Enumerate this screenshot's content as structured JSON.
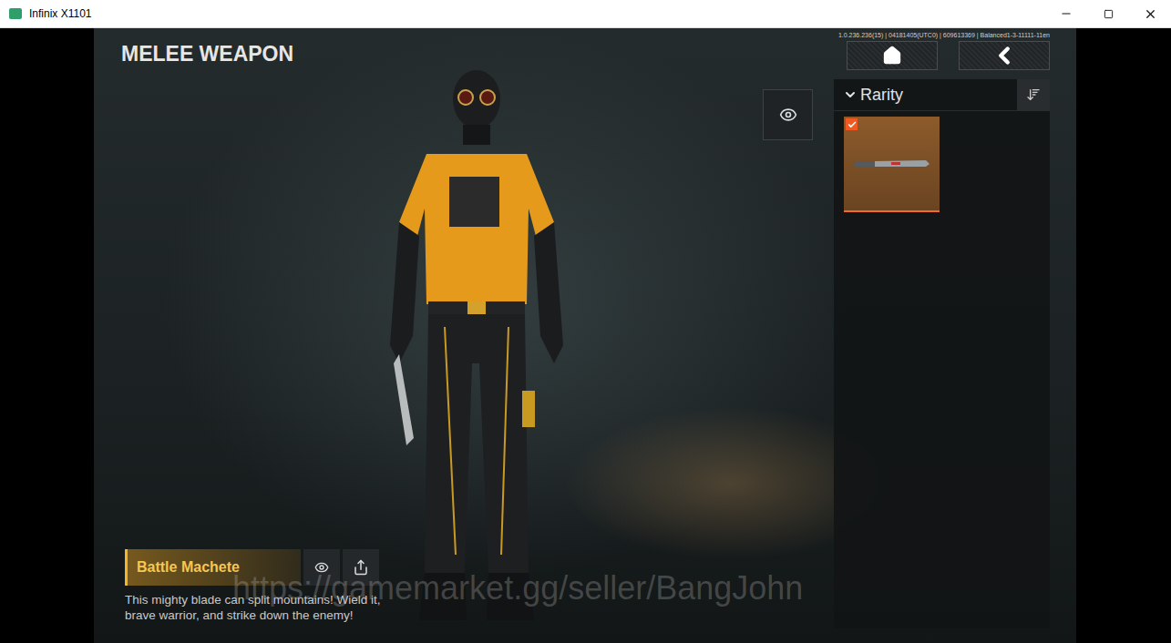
{
  "window": {
    "title": "Infinix X1101"
  },
  "page": {
    "title": "MELEE WEAPON",
    "build_info": "1.0.236.236(15) | 04181405(UTC0) | 609613369 | Balanced1-3-11111-11en"
  },
  "filter": {
    "label": "Rarity",
    "expanded": true
  },
  "items": [
    {
      "checked": true,
      "selected": true
    }
  ],
  "selected_item": {
    "name": "Battle Machete",
    "description": "This mighty blade can split mountains! Wield it, brave warrior, and strike down the enemy!"
  },
  "watermark": "https://gamemarket.gg/seller/BangJohn"
}
